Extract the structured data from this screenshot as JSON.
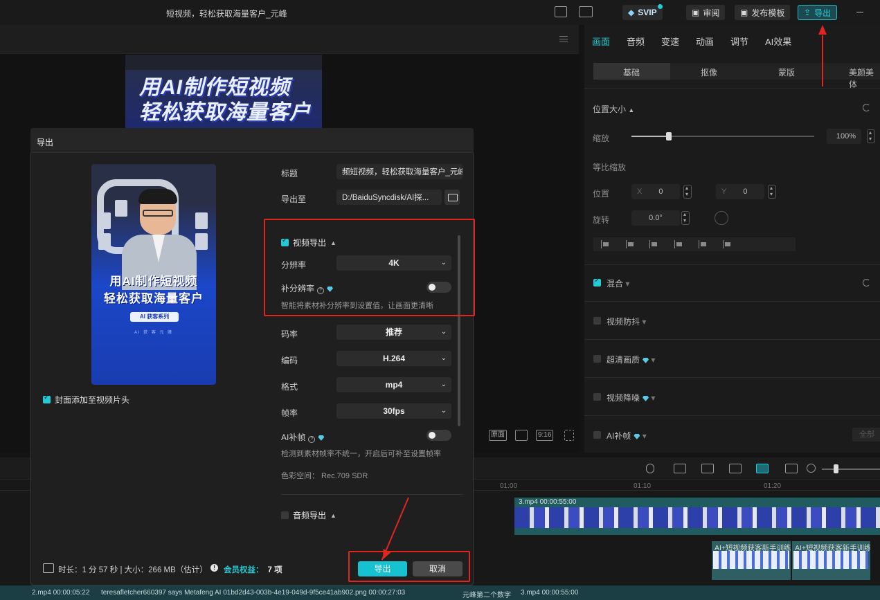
{
  "topbar": {
    "title": "短视频，轻松获取海量客户_元峰",
    "svip": "SVIP",
    "review": "审阅",
    "publish_template": "发布模板",
    "export": "导出"
  },
  "preview": {
    "banner_line1": "用AI制作短视频",
    "banner_line2": "轻松获取海量客户",
    "controls": [
      "原面",
      "9:16"
    ]
  },
  "right_panel": {
    "tabs": [
      "画面",
      "音频",
      "变速",
      "动画",
      "调节",
      "AI效果"
    ],
    "active_tab": "画面",
    "subtabs": [
      "基础",
      "抠像",
      "蒙版",
      "美颜美体"
    ],
    "position_size": "位置大小",
    "scale_label": "缩放",
    "scale_value": "100%",
    "uniform_scale": "等比缩放",
    "position_label": "位置",
    "x_label": "X",
    "x_value": "0",
    "y_label": "Y",
    "y_value": "0",
    "rotate_label": "旋转",
    "rotate_value": "0.0°",
    "blend": "混合",
    "stabilize": "视频防抖",
    "super_res": "超清画质",
    "denoise": "视频降噪",
    "ai_interp": "AI补帧",
    "apply_all": "全部"
  },
  "timeline": {
    "ticks": [
      "01:00",
      "01:10",
      "01:20"
    ],
    "clip1_label": "3.mp4  00:00:55:00",
    "clip2_label": "AI+短视频获客新手训练",
    "clip3_label": "AI+短视频获客新手训练",
    "bottom_items": [
      "2.mp4  00:00:05:22",
      "teresafletcher660397 says Metafeng AI 01bd2d43-003b-4e19-049d-9f5ce41ab902.png  00:00:27:03",
      "元峰第二个数字",
      "3.mp4  00:00:55:00"
    ]
  },
  "modal": {
    "title": "导出",
    "cover_line1": "用AI制作短视频",
    "cover_line2": "轻松获取海量客户",
    "cover_pill": "AI 获客系列",
    "cover_small": "AI 获 客 元 峰",
    "add_cover_label": "封面添加至视频片头",
    "title_label": "标题",
    "title_value": "频短视频，轻松获取海量客户_元峰",
    "export_to_label": "导出至",
    "export_path": "D:/BaiduSyncdisk/AI探...",
    "video_export": "视频导出",
    "resolution_label": "分辨率",
    "resolution_value": "4K",
    "upscale_label": "补分辨率",
    "upscale_hint": "智能将素材补分辨率到设置值，让画面更清晰",
    "bitrate_label": "码率",
    "bitrate_value": "推荐",
    "codec_label": "编码",
    "codec_value": "H.264",
    "format_label": "格式",
    "format_value": "mp4",
    "fps_label": "帧率",
    "fps_value": "30fps",
    "ai_interp_label": "AI补帧",
    "ai_interp_hint": "检测到素材帧率不统一，开启后可补至设置帧率",
    "color_space": "色彩空间：  Rec.709 SDR",
    "audio_export": "音频导出",
    "duration_info": "时长：1 分 57 秒 | 大小：266 MB（估计）",
    "vip_label": "会员权益：",
    "vip_count": "7 项",
    "export_button": "导出",
    "cancel_button": "取消"
  },
  "colors": {
    "accent": "#23c9d4",
    "annotation_red": "#e0261f"
  }
}
